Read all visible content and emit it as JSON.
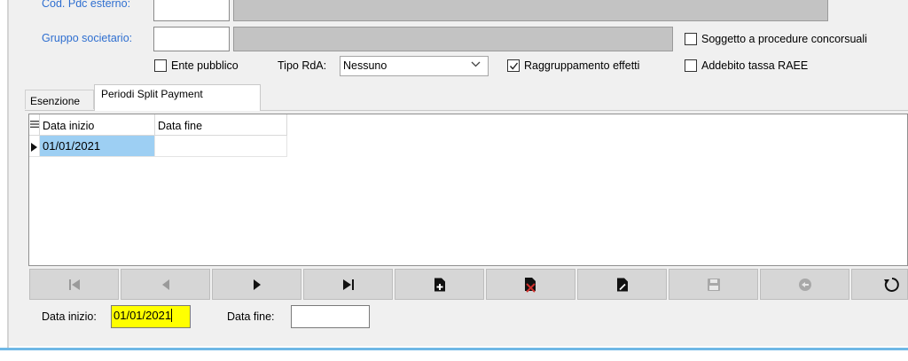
{
  "form": {
    "pdc_label": "Cod. Pdc esterno:",
    "gruppo_label": "Gruppo societario:",
    "soggetto_label": "Soggetto a procedure concorsuali",
    "ente_label": "Ente pubblico",
    "tipo_rda_label": "Tipo RdA:",
    "tipo_rda_value": "Nessuno",
    "raggruppamento_label": "Raggruppamento effetti",
    "addebito_label": "Addebito tassa RAEE",
    "checkboxes": {
      "soggetto": false,
      "ente": false,
      "raggruppamento": true,
      "addebito": false
    }
  },
  "tabs": [
    {
      "label": "Esenzione",
      "active": false
    },
    {
      "label": "Periodi Split Payment",
      "active": true
    }
  ],
  "grid": {
    "columns": [
      "Data inizio",
      "Data fine"
    ],
    "rows": [
      {
        "data_inizio": "01/01/2021",
        "data_fine": ""
      }
    ]
  },
  "navigator": {
    "buttons": [
      {
        "icon": "first-record-icon",
        "enabled": false
      },
      {
        "icon": "prior-record-icon",
        "enabled": false
      },
      {
        "icon": "next-record-icon",
        "enabled": true
      },
      {
        "icon": "last-record-icon",
        "enabled": true
      },
      {
        "icon": "insert-record-icon",
        "enabled": true
      },
      {
        "icon": "delete-record-icon",
        "enabled": true
      },
      {
        "icon": "edit-record-icon",
        "enabled": true
      },
      {
        "icon": "post-record-icon",
        "enabled": false
      },
      {
        "icon": "cancel-edit-icon",
        "enabled": false
      },
      {
        "icon": "refresh-icon",
        "enabled": true
      }
    ]
  },
  "edit": {
    "data_inizio_label": "Data inizio:",
    "data_inizio_value": "01/01/2021",
    "data_fine_label": "Data fine:",
    "data_fine_value": ""
  },
  "colors": {
    "label_blue": "#2f6fd0",
    "selection": "#9dcff3",
    "focus_yellow": "#ffff00",
    "frame_accent": "#6fb8e6"
  }
}
